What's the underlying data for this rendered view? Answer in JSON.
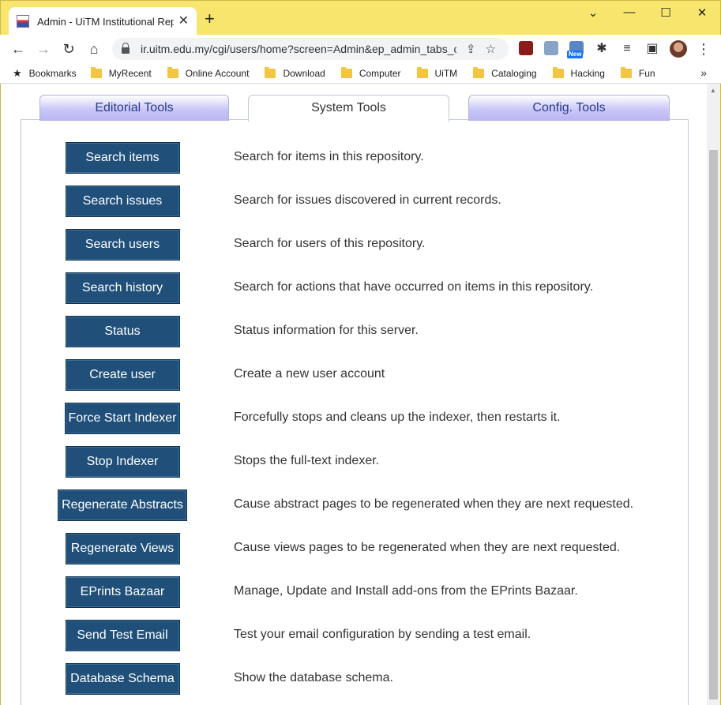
{
  "browser": {
    "tab_title": "Admin - UiTM Institutional Repository",
    "tab_close": "✕",
    "new_tab": "+",
    "url": "ir.uitm.edu.my/cgi/users/home?screen=Admin&ep_admin_tabs_current=system",
    "new_badge": "New",
    "bookmarks": [
      {
        "label": "Bookmarks",
        "icon": "star-icon"
      },
      {
        "label": "MyRecent",
        "icon": "folder-icon"
      },
      {
        "label": "Online Account",
        "icon": "folder-icon"
      },
      {
        "label": "Download",
        "icon": "folder-icon"
      },
      {
        "label": "Computer",
        "icon": "folder-icon"
      },
      {
        "label": "UiTM",
        "icon": "folder-icon"
      },
      {
        "label": "Cataloging",
        "icon": "folder-icon"
      },
      {
        "label": "Hacking",
        "icon": "folder-icon"
      },
      {
        "label": "Fun",
        "icon": "folder-icon"
      }
    ],
    "bookmarks_more": "»"
  },
  "admin": {
    "tabs": [
      {
        "label": "Editorial Tools",
        "active": false
      },
      {
        "label": "System Tools",
        "active": true
      },
      {
        "label": "Config. Tools",
        "active": false
      }
    ],
    "tools": [
      {
        "label": "Search items",
        "desc": "Search for items in this repository."
      },
      {
        "label": "Search issues",
        "desc": "Search for issues discovered in current records."
      },
      {
        "label": "Search users",
        "desc": "Search for users of this repository."
      },
      {
        "label": "Search history",
        "desc": "Search for actions that have occurred on items in this repository."
      },
      {
        "label": "Status",
        "desc": "Status information for this server."
      },
      {
        "label": "Create user",
        "desc": "Create a new user account"
      },
      {
        "label": "Force Start Indexer",
        "desc": "Forcefully stops and cleans up the indexer, then restarts it."
      },
      {
        "label": "Stop Indexer",
        "desc": "Stops the full-text indexer."
      },
      {
        "label": "Regenerate Abstracts",
        "desc": "Cause abstract pages to be regenerated when they are next requested."
      },
      {
        "label": "Regenerate Views",
        "desc": "Cause views pages to be regenerated when they are next requested."
      },
      {
        "label": "EPrints Bazaar",
        "desc": "Manage, Update and Install add-ons from the EPrints Bazaar."
      },
      {
        "label": "Send Test Email",
        "desc": "Test your email configuration by sending a test email."
      },
      {
        "label": "Database Schema",
        "desc": "Show the database schema."
      }
    ]
  },
  "colors": {
    "titlebar": "#f8e56d",
    "button_bg": "#20507a",
    "tab_inactive": "#c9c7f7"
  }
}
